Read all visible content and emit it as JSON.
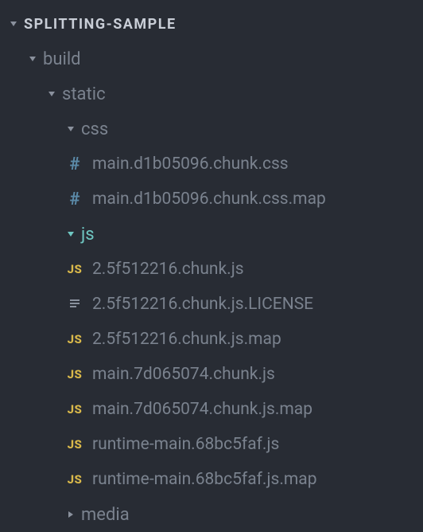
{
  "root": {
    "label": "SPLITTING-SAMPLE"
  },
  "folders": {
    "build": "build",
    "static": "static",
    "css": "css",
    "js": "js",
    "media": "media"
  },
  "files": {
    "css1": "main.d1b05096.chunk.css",
    "css2": "main.d1b05096.chunk.css.map",
    "js1": "2.5f512216.chunk.js",
    "js2": "2.5f512216.chunk.js.LICENSE",
    "js3": "2.5f512216.chunk.js.map",
    "js4": "main.7d065074.chunk.js",
    "js5": "main.7d065074.chunk.js.map",
    "js6": "runtime-main.68bc5faf.js",
    "js7": "runtime-main.68bc5faf.js.map"
  },
  "iconLabels": {
    "js": "JS",
    "hash": "#"
  }
}
